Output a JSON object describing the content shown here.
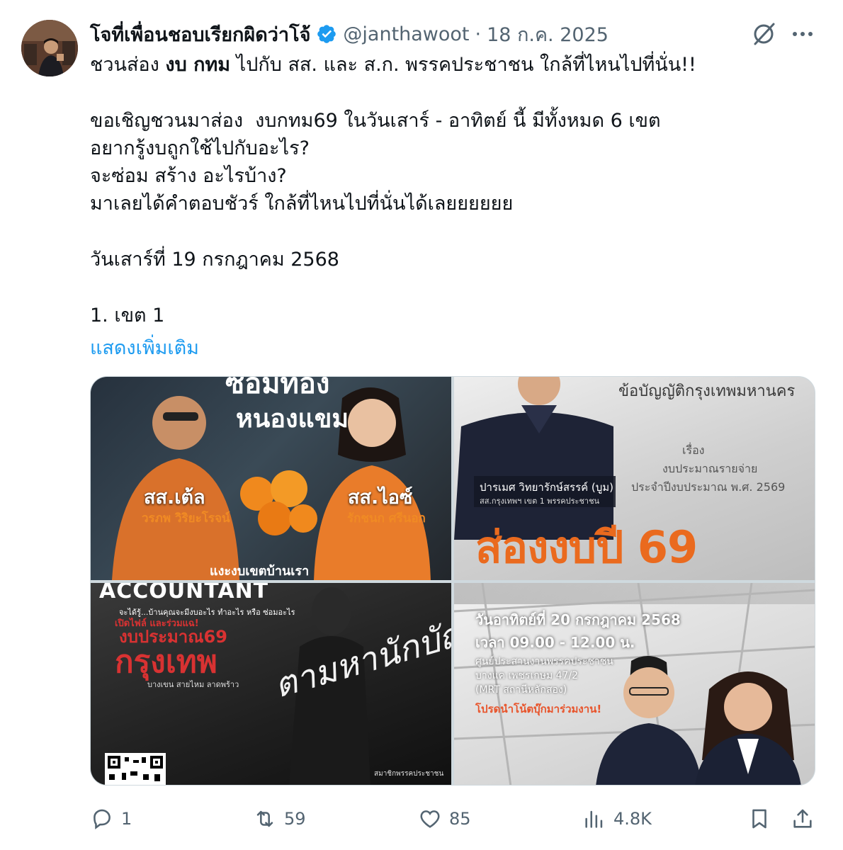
{
  "author": {
    "display_name": "โจที่เพื่อนชอบเรียกผิดว่าโจ้",
    "handle": "@janthawoot",
    "separator": "·",
    "date": "18 ก.ค. 2025",
    "verified": true
  },
  "post": {
    "line1_a": "ชวนส่อง ",
    "line1_b": "งบ กทม",
    "line1_c": " ไปกับ สส. และ ส.ก. พรรคประชาชน ใกล้ที่ไหนไปที่นั่น!!",
    "paragraph2": "ขอเชิญชวนมาส่อง  งบกทม69 ในวันเสาร์ - อาทิตย์ นี้ มีทั้งหมด 6 เขต\nอยากรู้งบถูกใช้ไปกับอะไร?\nจะซ่อม สร้าง อะไรบ้าง?\nมาเลยได้คำตอบชัวร์ ใกล้ที่ไหนไปที่นั่นได้เลยยยยยย",
    "paragraph3": "วันเสาร์ที่ 19 กรกฎาคม 2568",
    "paragraph4": "1. เขต 1",
    "show_more": "แสดงเพิ่มเติม"
  },
  "media": {
    "tile1": {
      "headline_1": "ซ่อมท้อง",
      "headline_2": "หนองแขม",
      "label_left": "สส.เต้ล",
      "sub_left": "วรภพ วิริยะโรจน์",
      "label_right": "สส.ไอซ์",
      "sub_right": "รักชนก ศรีนอก",
      "footer": "แงะงบเขตบ้านเรา"
    },
    "tile2": {
      "header": "ข้อบัญญัติกรุงเทพมหานคร",
      "line1": "เรื่อง",
      "line2": "งบประมาณรายจ่าย",
      "line3": "ประจำปีงบประมาณ พ.ศ. 2569",
      "name": "ปารเมศ วิทยารักษ์สรรค์ (บูม)",
      "role": "สส.กรุงเทพฯ เขต 1 พรรคประชาชน",
      "big_text": "ส่องงบปี 69"
    },
    "tile3": {
      "header": "ACCOUNTANT",
      "subheader": "จะได้รู้...บ้านคุณจะมีงบอะไร ทำอะไร หรือ ซ่อมอะไร",
      "red1": "เปิดไฟล์ และร่วมแฉ!",
      "red2": "งบประมาณ69",
      "red3": "กรุงเทพ",
      "districts": "บางเขน  สายไหม  ลาดพร้าว",
      "script": "ตามหานักบัญชี",
      "footer": "สมาชิกพรรคประชาชน"
    },
    "tile4": {
      "date": "วันอาทิตย์ที่ 20 กรกฎาคม 2568",
      "time": "เวลา 09.00 - 12.00 น.",
      "loc1": "ศูนย์ประสานงานพรรคประชาชน",
      "loc2": "บางแค เพชรเกษม 47/2",
      "loc3": "(MRT สถานีหลักสอง)",
      "cta": "โปรดนำโน้ตบุ๊กมาร่วมงาน!"
    }
  },
  "actions": {
    "replies": "1",
    "reposts": "59",
    "likes": "85",
    "views": "4.8K"
  },
  "colors": {
    "text": "#0f1419",
    "secondary": "#536471",
    "link": "#1d9bf0",
    "verified": "#1d9bf0",
    "orange_accent": "#ea6a1e"
  },
  "icons": [
    "verified-badge-icon",
    "grok-icon",
    "more-icon",
    "reply-icon",
    "repost-icon",
    "like-icon",
    "views-icon",
    "bookmark-icon",
    "share-icon"
  ]
}
